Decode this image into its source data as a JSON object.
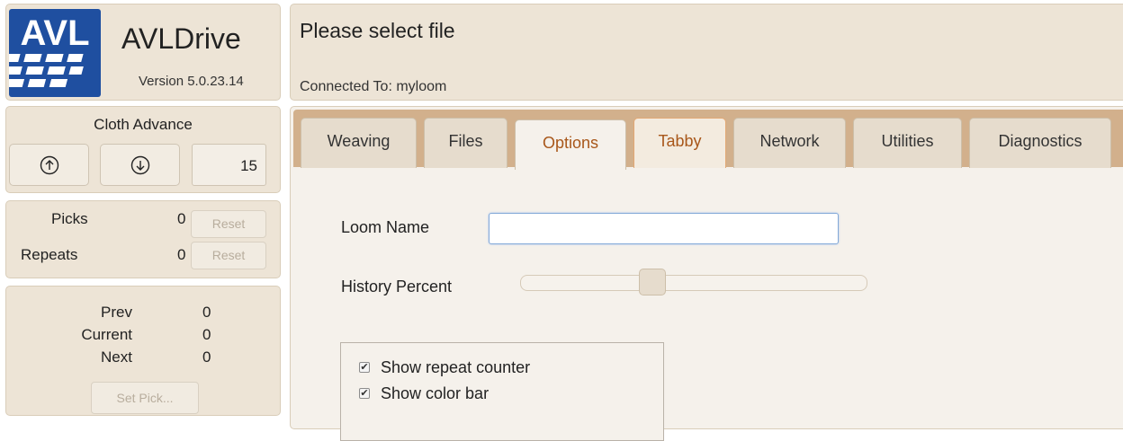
{
  "brand": {
    "logo_text": "AVL",
    "app_name": "AVLDrive",
    "version": "Version 5.0.23.14",
    "logo_color": "#1f4fa0"
  },
  "header": {
    "title": "Please select file",
    "connection": "Connected To: myloom"
  },
  "cloth_advance": {
    "title": "Cloth Advance",
    "up_icon": "arrow-up-circle-icon",
    "down_icon": "arrow-down-circle-icon",
    "value": "15"
  },
  "counters": {
    "picks_label": "Picks",
    "picks_value": "0",
    "repeats_label": "Repeats",
    "repeats_value": "0",
    "reset_label": "Reset"
  },
  "pick": {
    "prev_label": "Prev",
    "prev_value": "0",
    "current_label": "Current",
    "current_value": "0",
    "next_label": "Next",
    "next_value": "0",
    "set_pick_label": "Set Pick..."
  },
  "tabs": [
    {
      "label": "Weaving",
      "state": "normal"
    },
    {
      "label": "Files",
      "state": "normal"
    },
    {
      "label": "Options",
      "state": "active"
    },
    {
      "label": "Tabby",
      "state": "hover"
    },
    {
      "label": "Network",
      "state": "normal"
    },
    {
      "label": "Utilities",
      "state": "normal"
    },
    {
      "label": "Diagnostics",
      "state": "normal"
    }
  ],
  "options": {
    "loom_name_label": "Loom Name",
    "loom_name_value": "",
    "history_label": "History Percent",
    "history_percent": 38,
    "checkboxes": [
      {
        "label": "Show repeat counter",
        "checked": true
      },
      {
        "label": "Show color bar",
        "checked": true
      }
    ]
  },
  "colors": {
    "panel": "#ede4d6",
    "tab_bar": "#d2b08c",
    "active_tab_text": "#a8571a",
    "input_focus": "#84a9d8"
  }
}
